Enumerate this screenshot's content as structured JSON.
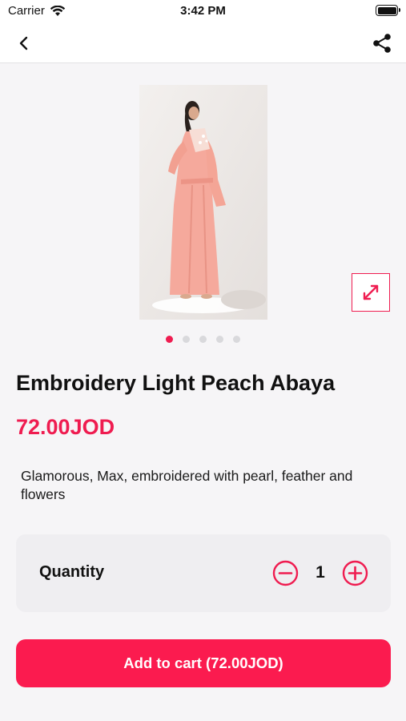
{
  "status_bar": {
    "carrier": "Carrier",
    "time": "3:42 PM",
    "icons": [
      "wifi-icon",
      "battery-icon"
    ]
  },
  "nav": {
    "icons": [
      "back-chevron-icon",
      "share-icon"
    ]
  },
  "product": {
    "image_icon": "product-photo-abaya",
    "expand_icon": "expand-arrows-icon",
    "carousel": {
      "count": 5,
      "active_index": 0
    },
    "title": "Embroidery Light Peach Abaya",
    "price": "72.00JOD",
    "description": "Glamorous, Max, embroidered with pearl, feather and flowers"
  },
  "quantity": {
    "label": "Quantity",
    "value": "1",
    "icons": [
      "minus-circle-icon",
      "plus-circle-icon"
    ]
  },
  "cart": {
    "button_label": "Add to cart (72.00JOD)"
  },
  "colors": {
    "accent": "#ef1c50",
    "button": "#fb1b4f",
    "background": "#f6f5f7",
    "card": "#efeef1"
  }
}
